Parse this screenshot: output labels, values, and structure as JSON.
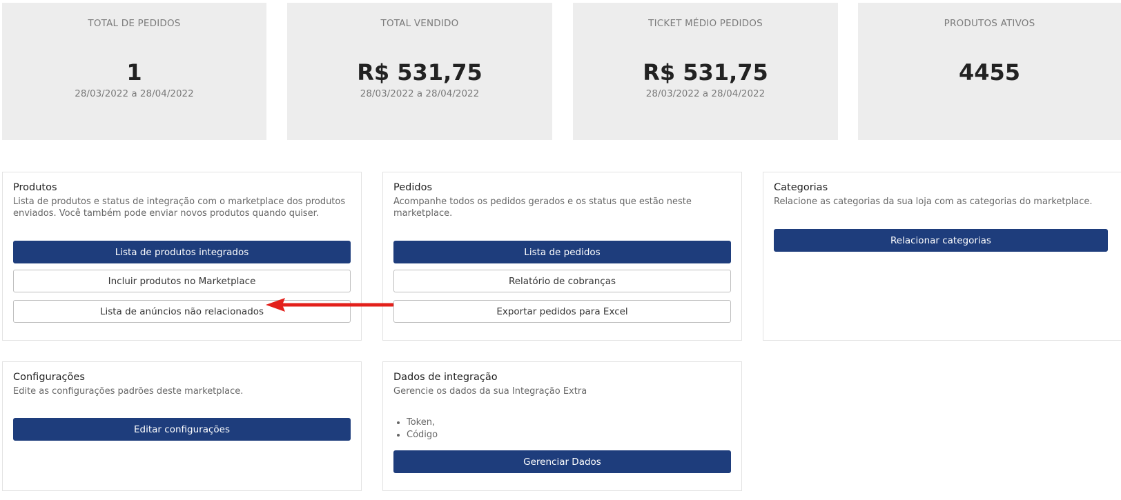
{
  "stats": [
    {
      "label": "TOTAL DE PEDIDOS",
      "value": "1",
      "period": "28/03/2022 a 28/04/2022"
    },
    {
      "label": "TOTAL VENDIDO",
      "value": "R$ 531,75",
      "period": "28/03/2022 a 28/04/2022"
    },
    {
      "label": "TICKET MÉDIO PEDIDOS",
      "value": "R$ 531,75",
      "period": "28/03/2022 a 28/04/2022"
    },
    {
      "label": "PRODUTOS ATIVOS",
      "value": "4455"
    }
  ],
  "produtos": {
    "title": "Produtos",
    "description": "Lista de produtos e status de integração com o marketplace dos produtos enviados. Você também pode enviar novos produtos quando quiser.",
    "btn_list": "Lista de produtos integrados",
    "btn_include": "Incluir produtos no Marketplace",
    "btn_unrelated": "Lista de anúncios não relacionados"
  },
  "pedidos": {
    "title": "Pedidos",
    "description": "Acompanhe todos os pedidos gerados e os status que estão neste marketplace.",
    "btn_list": "Lista de pedidos",
    "btn_report": "Relatório de cobranças",
    "btn_export": "Exportar pedidos para Excel"
  },
  "categorias": {
    "title": "Categorias",
    "description": "Relacione as categorias da sua loja com as categorias do marketplace.",
    "btn_relate": "Relacionar categorias"
  },
  "configuracoes": {
    "title": "Configurações",
    "description": "Edite as configurações padrões deste marketplace.",
    "btn_edit": "Editar configurações"
  },
  "integracao": {
    "title": "Dados de integração",
    "description": "Gerencie os dados da sua Integração Extra",
    "items": [
      "Token,",
      "Código"
    ],
    "btn_manage": "Gerenciar Dados"
  },
  "colors": {
    "primary": "#1e3d7c",
    "stat_bg": "#ededed",
    "arrow": "#e3201b"
  },
  "annotation": {
    "icon": "red-arrow-left-icon"
  }
}
